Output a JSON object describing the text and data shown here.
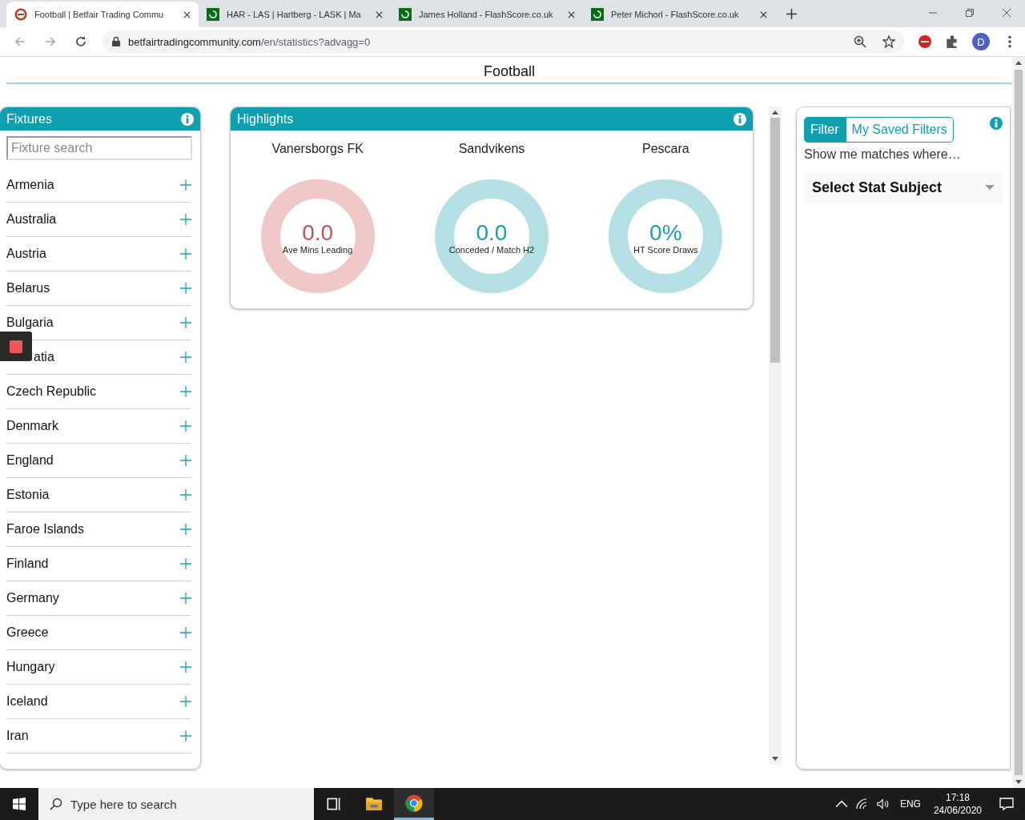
{
  "browser": {
    "tabs": [
      {
        "title": "Football | Betfair Trading Commu",
        "selected": true,
        "kind": "btc"
      },
      {
        "title": "HAR - LAS | Hartberg - LASK | Ma",
        "selected": false,
        "kind": "flashscore"
      },
      {
        "title": "James Holland - FlashScore.co.uk",
        "selected": false,
        "kind": "flashscore"
      },
      {
        "title": "Peter Michorl - FlashScore.co.uk",
        "selected": false,
        "kind": "flashscore"
      }
    ],
    "address": {
      "host": "betfairtradingcommunity.com",
      "path": "/en/statistics?advagg=0"
    },
    "profile_initial": "D"
  },
  "page": {
    "title": "Football"
  },
  "fixtures": {
    "title": "Fixtures",
    "search": {
      "placeholder": "Fixture search"
    },
    "countries": [
      {
        "name": "Armenia",
        "kind": "country"
      },
      {
        "name": "Australia",
        "kind": "country"
      },
      {
        "name": "Austria",
        "kind": "country"
      },
      {
        "name": "Belarus",
        "kind": "country"
      },
      {
        "name": "Bulgaria",
        "kind": "country"
      },
      {
        "name": "atia",
        "kind": "covered"
      },
      {
        "name": "Czech Republic",
        "kind": "country"
      },
      {
        "name": "Denmark",
        "kind": "country"
      },
      {
        "name": "England",
        "kind": "country"
      },
      {
        "name": "Estonia",
        "kind": "country"
      },
      {
        "name": "Faroe Islands",
        "kind": "country"
      },
      {
        "name": "Finland",
        "kind": "country"
      },
      {
        "name": "Germany",
        "kind": "country"
      },
      {
        "name": "Greece",
        "kind": "country"
      },
      {
        "name": "Hungary",
        "kind": "country"
      },
      {
        "name": "Iceland",
        "kind": "country"
      },
      {
        "name": "Iran",
        "kind": "country"
      }
    ]
  },
  "highlights": {
    "title": "Highlights",
    "items": [
      {
        "team": "Vanersborgs FK",
        "value": "0.0",
        "label": "Ave Mins Leading",
        "color": "#c9514f"
      },
      {
        "team": "Sandvikens",
        "value": "0.0",
        "label": "Conceded / Match H2",
        "color": "#1a9ea8"
      },
      {
        "team": "Pescara",
        "value": "0%",
        "label": "HT Score Draws",
        "color": "#1a9ea8"
      }
    ]
  },
  "filter": {
    "tabs": [
      {
        "label": "Filter",
        "selected": true
      },
      {
        "label": "My Saved Filters",
        "selected": false
      }
    ],
    "prompt": "Show me matches where…",
    "select": {
      "value": "Select Stat Subject"
    }
  },
  "taskbar": {
    "search": {
      "placeholder": "Type here to search"
    },
    "apps": [
      {
        "kind": "task-view",
        "active": false
      },
      {
        "kind": "explorer",
        "active": false
      },
      {
        "kind": "chrome",
        "active": true
      }
    ],
    "language": "ENG",
    "time": "17:18",
    "date": "24/06/2020"
  }
}
